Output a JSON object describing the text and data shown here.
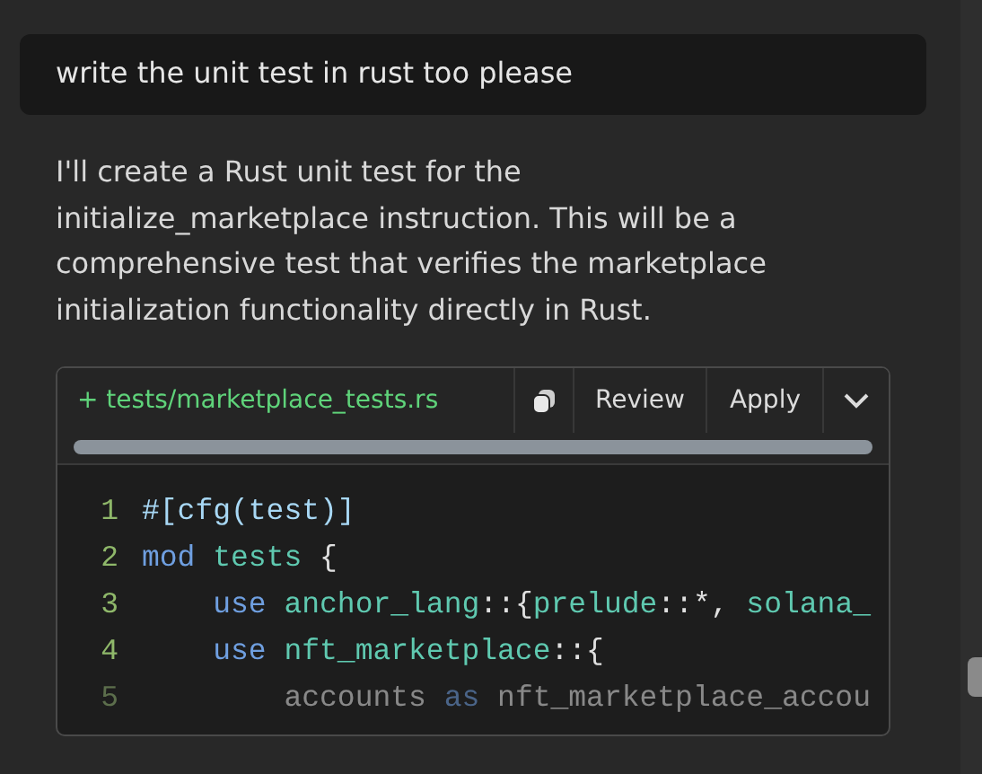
{
  "user_message": "write the unit test in rust too please",
  "reply": "I'll create a Rust unit test for the initialize_marketplace instruction. This will be a comprehensive test that verifies the marketplace initialization functionality directly in Rust.",
  "code_block": {
    "file": "+ tests/marketplace_tests.rs",
    "actions": [
      "Review",
      "Apply"
    ],
    "lines": [
      {
        "number": "1",
        "faded": false,
        "tokens": [
          {
            "kind": "attr",
            "text": "#[cfg(test)]"
          }
        ]
      },
      {
        "number": "2",
        "faded": false,
        "tokens": [
          {
            "kind": "keyword",
            "text": "mod"
          },
          {
            "kind": "ident",
            "text": " tests"
          },
          {
            "kind": "plain",
            "text": " {"
          }
        ]
      },
      {
        "number": "3",
        "faded": false,
        "tokens": [
          {
            "kind": "keyword",
            "text": "    use"
          },
          {
            "kind": "ident",
            "text": " anchor_lang"
          },
          {
            "kind": "plain",
            "text": "::{"
          },
          {
            "kind": "ident",
            "text": "prelude"
          },
          {
            "kind": "plain",
            "text": "::*,"
          },
          {
            "kind": "ident",
            "text": " solana_"
          }
        ]
      },
      {
        "number": "4",
        "faded": false,
        "tokens": [
          {
            "kind": "keyword",
            "text": "    use"
          },
          {
            "kind": "ident",
            "text": " nft_marketplace"
          },
          {
            "kind": "plain",
            "text": "::{"
          }
        ]
      },
      {
        "number": "5",
        "faded": true,
        "tokens": [
          {
            "kind": "plain",
            "text": "        accounts "
          },
          {
            "kind": "keyword",
            "text": "as"
          },
          {
            "kind": "plain",
            "text": " nft_marketplace_accou"
          }
        ]
      }
    ]
  }
}
